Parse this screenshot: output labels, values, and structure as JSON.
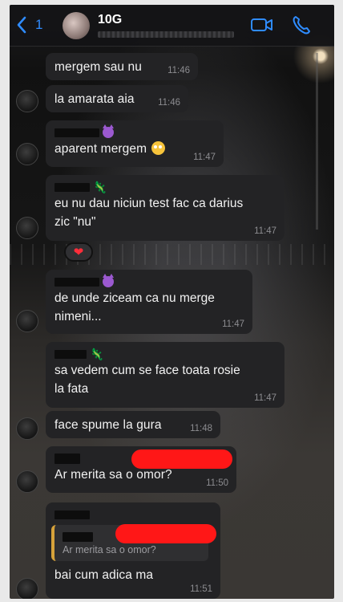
{
  "header": {
    "back_count": "1",
    "chat_name": "10G"
  },
  "icons": {
    "back": "chevron-left-icon",
    "video": "video-call-icon",
    "call": "phone-icon",
    "accent_color": "#2f8cff"
  },
  "messages": [
    {
      "text": "mergem sau nu",
      "time": "11:46"
    },
    {
      "text": "la amarata aia",
      "time": "11:46"
    },
    {
      "text": "aparent mergem",
      "emoji": "flushed-face",
      "time": "11:47"
    },
    {
      "text_line1": "eu nu dau niciun test fac ca darius",
      "text_line2": "zic \"nu\"",
      "time": "11:47",
      "reaction": "❤"
    },
    {
      "text_line1": "de unde ziceam ca nu merge",
      "text_line2": "nimeni...",
      "time": "11:47"
    },
    {
      "text_line1": "sa vedem cum se face toata rosie",
      "text_line2": "la fata",
      "time": "11:47"
    },
    {
      "text": "face spume la gura",
      "time": "11:48"
    },
    {
      "text": "Ar merita sa o omor?",
      "time": "11:50"
    },
    {
      "quote": "Ar merita sa o omor?",
      "text": "bai cum adica ma",
      "time": "11:51"
    }
  ]
}
